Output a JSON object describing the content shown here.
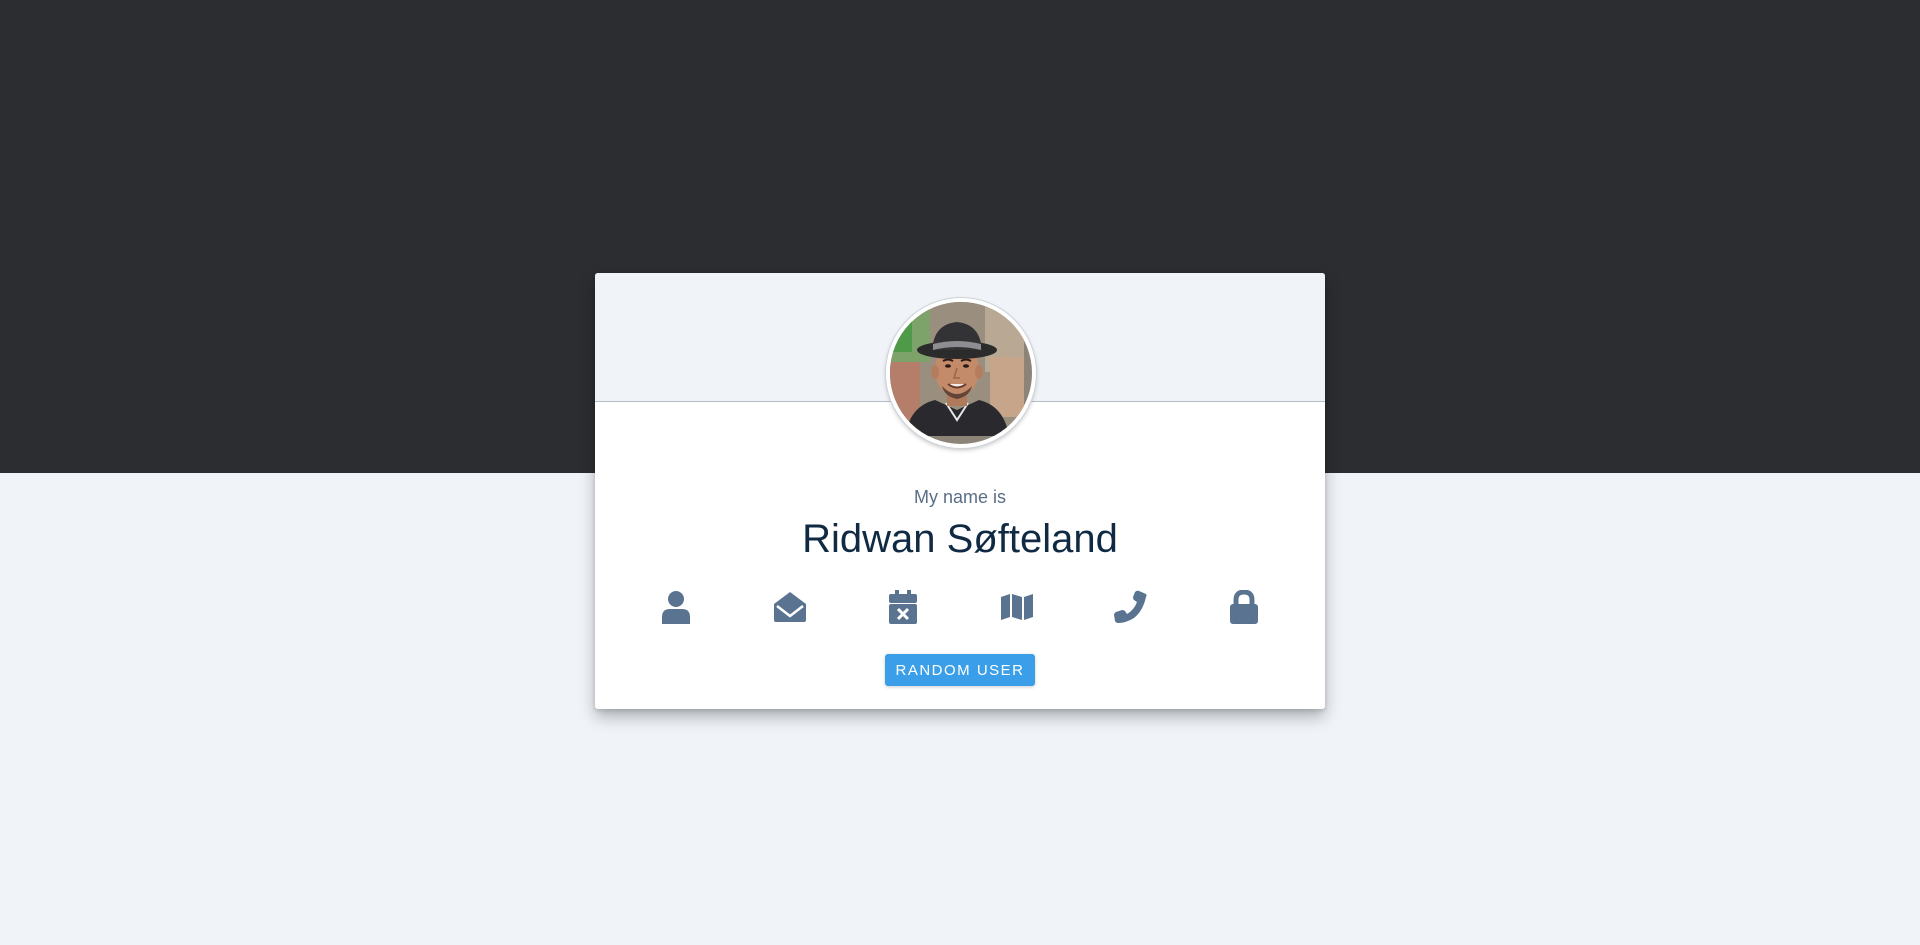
{
  "card": {
    "label": "My name is",
    "value": "Ridwan Søfteland",
    "avatar_alt": "Ridwan Søfteland"
  },
  "icons": [
    {
      "name": "user-icon"
    },
    {
      "name": "envelope-open-icon"
    },
    {
      "name": "calendar-times-icon"
    },
    {
      "name": "map-icon"
    },
    {
      "name": "phone-icon"
    },
    {
      "name": "lock-icon"
    }
  ],
  "button": {
    "label": "RANDOM USER"
  },
  "colors": {
    "dark_band": "#2b2d31",
    "background": "#f0f4f8",
    "icon": "#5a7390",
    "name_text": "#102a43",
    "button": "#3a9fe8"
  }
}
